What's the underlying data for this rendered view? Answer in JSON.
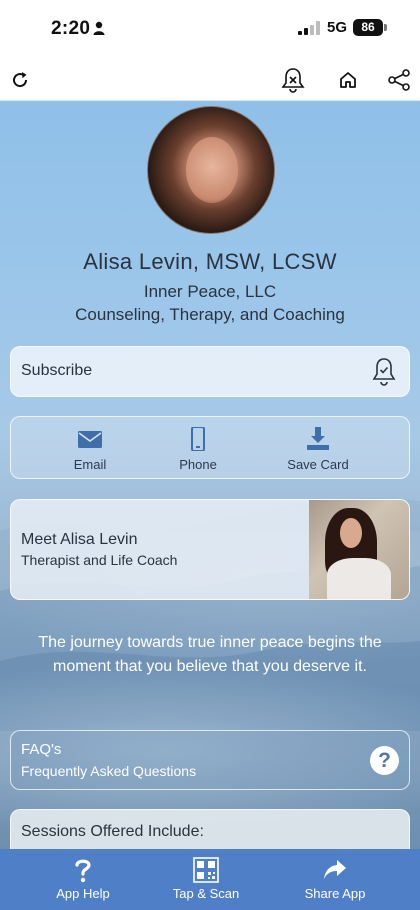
{
  "status_bar": {
    "time": "2:20",
    "network": "5G",
    "battery": "86"
  },
  "toolbar": {
    "icons": [
      "refresh-icon",
      "unsubscribe-bell-icon",
      "home-icon",
      "share-icon"
    ]
  },
  "profile": {
    "name": "Alisa Levin, MSW, LCSW",
    "company": "Inner Peace, LLC",
    "tagline": "Counseling, Therapy, and Coaching"
  },
  "subscribe": {
    "label": "Subscribe"
  },
  "contact": {
    "email": "Email",
    "phone": "Phone",
    "save_card": "Save Card"
  },
  "meet": {
    "title": "Meet Alisa Levin",
    "subtitle": "Therapist and Life Coach"
  },
  "quote": "The journey towards true inner peace begins the moment that you believe that you deserve it.",
  "faq": {
    "title": "FAQ's",
    "subtitle": "Frequently Asked Questions",
    "icon": "?"
  },
  "sessions": {
    "title": "Sessions Offered Include:"
  },
  "bottom_bar": {
    "app_help": "App Help",
    "tap_scan": "Tap & Scan",
    "share_app": "Share App"
  },
  "colors": {
    "bottom_bar": "#4f7fc6",
    "icon_blue": "#3f6ea8"
  }
}
